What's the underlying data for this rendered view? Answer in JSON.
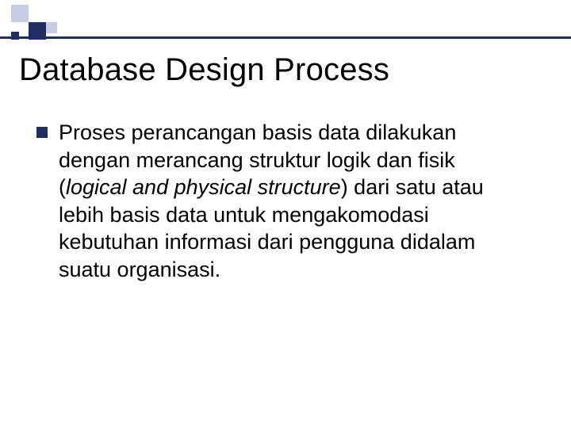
{
  "slide": {
    "title": "Database Design Process",
    "bullets": [
      {
        "pre": "Proses perancangan basis data dilakukan dengan merancang struktur logik dan fisik (",
        "italic": "logical and physical structure",
        "post": ") dari satu atau lebih basis data untuk mengakomodasi kebutuhan informasi dari pengguna didalam suatu organisasi."
      }
    ]
  }
}
